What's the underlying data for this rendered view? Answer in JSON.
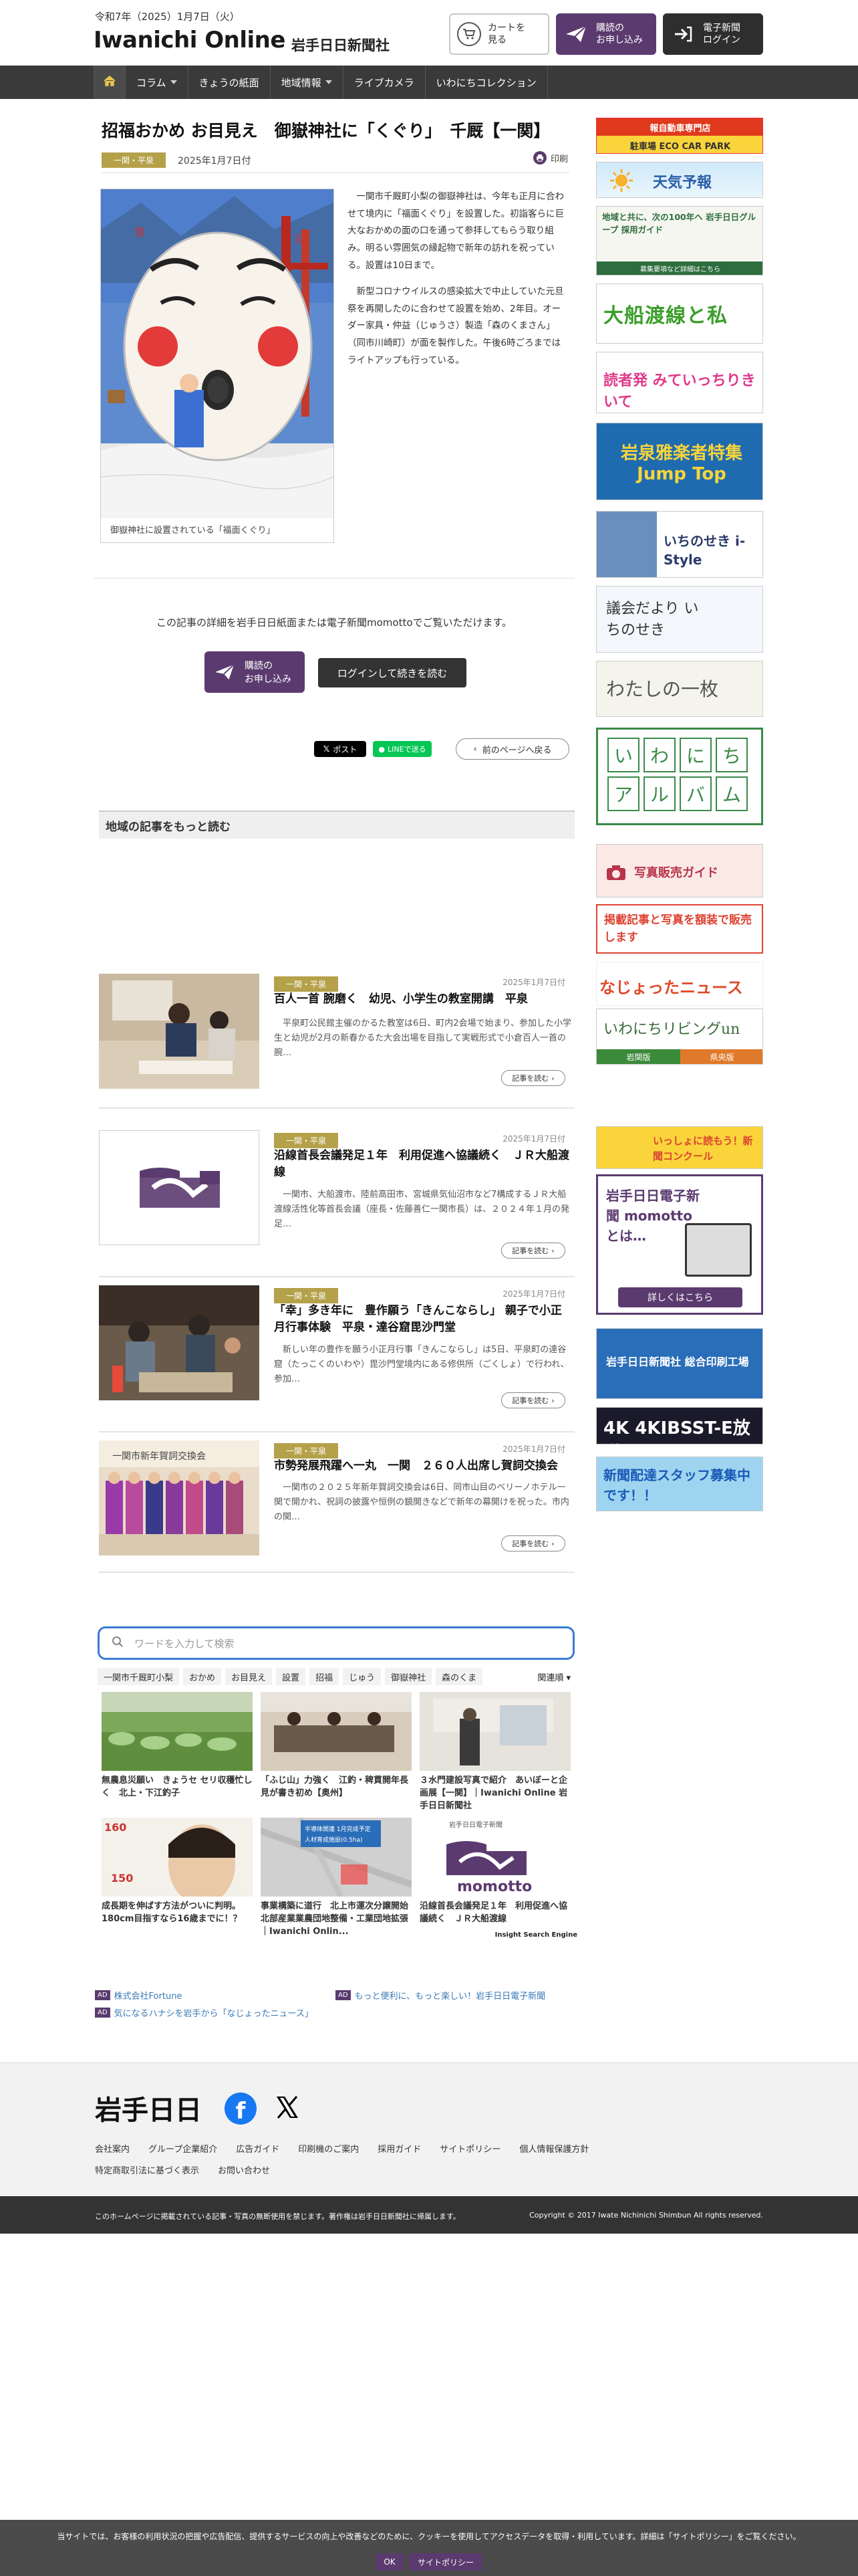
{
  "header": {
    "date": "令和7年（2025）1月7日（火）",
    "logo": "Iwanichi Online",
    "sub": "岩手日日新聞社",
    "cart_label": "カートを\n見る",
    "subscribe_label": "購読の\nお申し込み",
    "login_label": "電子新聞\nログイン"
  },
  "nav": {
    "items": [
      "コラム",
      "きょうの紙面",
      "地域情報",
      "ライブカメラ",
      "いわにちコレクション"
    ]
  },
  "article": {
    "title": "招福おかめ お目見え　御嶽神社に「くぐり」　千厩【一関】",
    "tag": "一関・平泉",
    "date": "2025年1月7日付",
    "print": "印刷",
    "caption": "御嶽神社に設置されている「福面くぐり」",
    "para1": "一関市千厩町小梨の御嶽神社は、今年も正月に合わせて境内に「福面くぐり」を設置した。初詣客らに巨大なおかめの面の口を通って参拝してもらう取り組み。明るい雰囲気の縁起物で新年の訪れを祝っている。設置は10日まで。",
    "para2": "新型コロナウイルスの感染拡大で中止していた元旦祭を再開したのに合わせて設置を始め、2年目。オーダー家具・仲益（じゅうさ）製造「森のくまさん」（同市川崎町）が面を製作した。午後6時ごろまではライトアップも行っている。",
    "paywall": "この記事の詳細を岩手日日紙面または電子新聞momottoでご覧いただけます。",
    "pw_subscribe": "購読の\nお申し込み",
    "pw_login": "ログインして続きを読む",
    "share_x": "ポスト",
    "share_line": "LINEで送る",
    "back": "前のページへ戻る"
  },
  "region": {
    "heading": "地域の記事をもっと読む",
    "items": [
      {
        "tag": "一関・平泉",
        "date": "2025年1月7日付",
        "title": "百人一首 腕磨く　幼児、小学生の教室開講　平泉",
        "excerpt": "平泉町公民館主催のかるた教室は6日、町内2会場で始まり、参加した小学生と幼児が2月の新春かるた大会出場を目指して実戦形式で小倉百人一首の腕…",
        "more": "記事を読む"
      },
      {
        "tag": "一関・平泉",
        "date": "2025年1月7日付",
        "title": "沿線首長会議発足１年　利用促進へ協議続く　ＪＲ大船渡線",
        "excerpt": "一関市、大船渡市、陸前高田市、宮城県気仙沼市など7構成するＪＲ大船渡線活性化等首長会議（座長・佐藤善仁一関市長）は、２０２４年１月の発足…",
        "more": "記事を読む"
      },
      {
        "tag": "一関・平泉",
        "date": "2025年1月7日付",
        "title": "「幸」多き年に　豊作願う「きんこならし」 親子で小正月行事体験　平泉・達谷窟毘沙門堂",
        "excerpt": "新しい年の豊作を願う小正月行事「きんこならし」は5日、平泉町の達谷窟（たっこくのいわや）毘沙門堂境内にある修供所（ごくしょ）で行われ、参加…",
        "more": "記事を読む"
      },
      {
        "tag": "一関・平泉",
        "date": "2025年1月7日付",
        "title": "市勢発展飛躍へ一丸　一関　２６０人出席し賀詞交換会",
        "excerpt": "一関市の２０２５年新年賀詞交換会は6日、同市山目のベリーノホテル一関で開かれ、祝詞の披露や恒例の鏡開きなどで新年の幕開けを祝った。市内の関…",
        "more": "記事を読む"
      }
    ]
  },
  "search": {
    "placeholder": "ワードを入力して検索",
    "keywords": [
      "一関市千厩町小梨",
      "おかめ",
      "お目見え",
      "設置",
      "招福",
      "じゅう",
      "御嶽神社",
      "森のくま"
    ],
    "select": "関連順",
    "cards": [
      {
        "title": "無農息災願い　きょうセ セリ収穫忙しく　北上・下江釣子"
      },
      {
        "title": "「ふじ山」力強く　江釣・稗貫開年長見が書き初め【奥州】"
      },
      {
        "title": "３水門建設写真で紹介　あいぼーと企画展【一関】｜Iwanichi Online 岩手日日新聞社"
      },
      {
        "title": "成長期を伸ばす方法がついに判明。180cm目指すなら16歳までに！？"
      },
      {
        "title": "事業構築に道行　北上市運次分譲開始　北部産業業農団地整備・工業団地拡張｜Iwanichi Onlin..."
      },
      {
        "title": "沿線首長会議発足１年　利用促進へ協議続く　ＪＲ大船渡線"
      }
    ],
    "card_img_text": [
      "",
      "",
      "",
      "160 / 150",
      "平場休閑適 1月完成予定 入財賃成施設(0.5ha)",
      "岩手日日電子新聞 momotto"
    ],
    "brand": "Insight Search Engine"
  },
  "ads": {
    "badge": "AD",
    "a1": "株式会社Fortune",
    "a2": "もっと便利に、もっと楽しい！岩手日日電子新聞",
    "a3": "気になるハナシを岩手から「なじょったニュース」"
  },
  "sidebar": {
    "banners": [
      {
        "text": "駐車場 ECO CAR PARK",
        "sub": "報自動車専門店"
      },
      {
        "text": "天気予報"
      },
      {
        "text": "地域と共に、次の100年へ 岩手日日グループ 採用ガイド",
        "sub": "募集要項など詳細はこちら"
      },
      {
        "text": "大船渡線と私"
      },
      {
        "text": "読者発 みていっちりきいて"
      },
      {
        "text": "岩泉雅楽者特集 Jump Top"
      },
      {
        "text": "いちのせき i-Style"
      },
      {
        "text": "議会だより いちのせき"
      },
      {
        "text": "わたしの一枚"
      },
      {
        "text": "いわにちアルバム",
        "chars": [
          "い",
          "わ",
          "に",
          "ち",
          "ア",
          "ル",
          "バ",
          "ム"
        ]
      },
      {
        "text": "写真販売ガイド"
      },
      {
        "text": "掲載記事と写真を額装で販売します"
      },
      {
        "text": "なじょったニュース"
      },
      {
        "text": "いわにちリビングun",
        "sub1": "岩関版",
        "sub2": "県央版"
      },
      {
        "text": "いっしょに読もう！新聞コンクール"
      },
      {
        "text": "岩手日日電子新聞 momotto とは…",
        "sub": "詳しくはこちら"
      },
      {
        "text": "岩手日日新聞社 総合印刷工場"
      },
      {
        "text": "4K 4KIBSST-E放送"
      },
      {
        "text": "新聞配達スタッフ募集中です！！"
      }
    ]
  },
  "footer": {
    "logo": "岩手日日",
    "links": [
      "会社案内",
      "グループ企業紹介",
      "広告ガイド",
      "印刷機のご案内",
      "採用ガイド",
      "サイトポリシー",
      "個人情報保護方針",
      "特定商取引法に基づく表示",
      "お問い合わせ"
    ],
    "copy_left": "このホームページに掲載されている記事・写真の無断使用を禁じます。著作権は岩手日日新聞社に帰属します。",
    "copy_right": "Copyright © 2017 Iwate Nichinichi Shimbun All rights reserved."
  },
  "cookie": {
    "text": "当サイトでは、お客様の利用状況の把握や広告配信、提供するサービスの向上や改善などのために、クッキーを使用してアクセスデータを取得・利用しています。詳細は「サイトポリシー」をご覧ください。",
    "ok": "OK",
    "policy": "サイトポリシー"
  },
  "colors": {
    "brand_purple": "#5b3b6f",
    "tag_gold": "#b5a14a",
    "nav_dark": "#3a3a3a"
  }
}
